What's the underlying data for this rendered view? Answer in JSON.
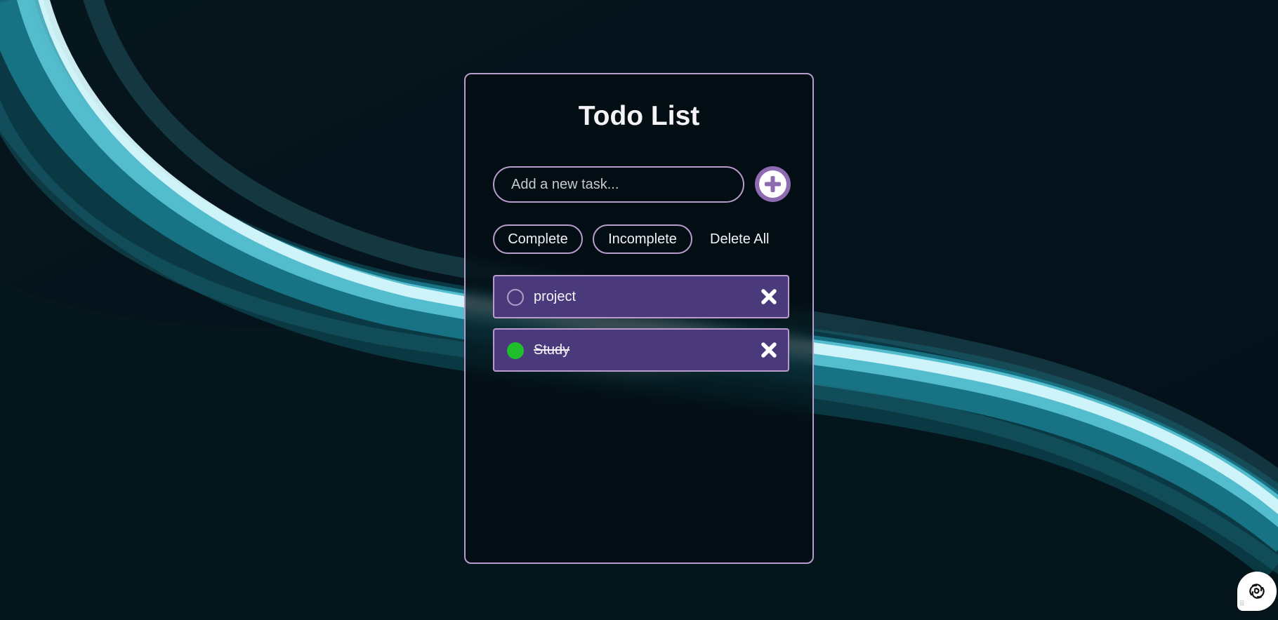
{
  "app": {
    "title": "Todo List"
  },
  "input": {
    "placeholder": "Add a new task...",
    "value": ""
  },
  "add_button": {
    "icon": "plus-circle-icon"
  },
  "filters": {
    "complete_label": "Complete",
    "incomplete_label": "Incomplete",
    "delete_all_label": "Delete All"
  },
  "tasks": [
    {
      "label": "project",
      "done": false,
      "remove_icon": "close-icon"
    },
    {
      "label": "Study",
      "done": true,
      "remove_icon": "close-icon"
    }
  ],
  "colors": {
    "accent_border": "#b79ccc",
    "task_bg": "#4a3a7c",
    "done_green": "#1fbf2c",
    "add_button": "#8e6ab0",
    "background": "#04121a"
  },
  "badge": {
    "icon": "assistant-logo-icon"
  }
}
